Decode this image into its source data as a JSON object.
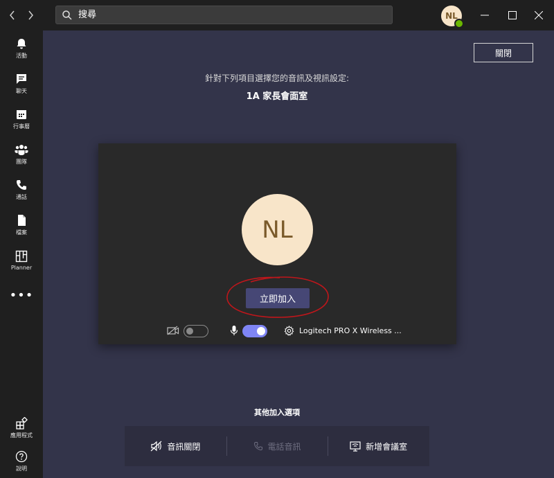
{
  "topbar": {
    "search_placeholder": "搜尋",
    "avatar_initials": "NL",
    "presence_color": "#6bb700"
  },
  "sidebar": {
    "items": [
      {
        "label": "活動",
        "icon": "bell-icon"
      },
      {
        "label": "聊天",
        "icon": "chat-icon"
      },
      {
        "label": "行事曆",
        "icon": "calendar-icon"
      },
      {
        "label": "團隊",
        "icon": "teams-icon"
      },
      {
        "label": "通話",
        "icon": "phone-icon"
      },
      {
        "label": "檔案",
        "icon": "file-icon"
      },
      {
        "label": "Planner",
        "icon": "planner-icon"
      }
    ],
    "more_label": "•••",
    "bottom": [
      {
        "label": "應用程式",
        "icon": "apps-icon"
      },
      {
        "label": "說明",
        "icon": "help-icon"
      }
    ]
  },
  "main": {
    "close_label": "關閉",
    "subtitle": "針對下列項目選擇您的音訊及視訊設定:",
    "meeting_title": "1A 家長會面室",
    "preview": {
      "avatar_initials": "NL",
      "join_label": "立即加入",
      "video_on": false,
      "mic_on": true,
      "device_label": "Logitech PRO X Wireless ..."
    },
    "other_options_title": "其他加入選項",
    "options": [
      {
        "label": "音訊關閉",
        "icon": "speaker-off-icon",
        "enabled": true
      },
      {
        "label": "電話音訊",
        "icon": "phone-icon",
        "enabled": false
      },
      {
        "label": "新增會議室",
        "icon": "room-icon",
        "enabled": true
      }
    ]
  },
  "colors": {
    "accent": "#464775",
    "toggle_on": "#7f85f5",
    "background": "#33344a",
    "avatar_bg": "#f8e5c9"
  }
}
